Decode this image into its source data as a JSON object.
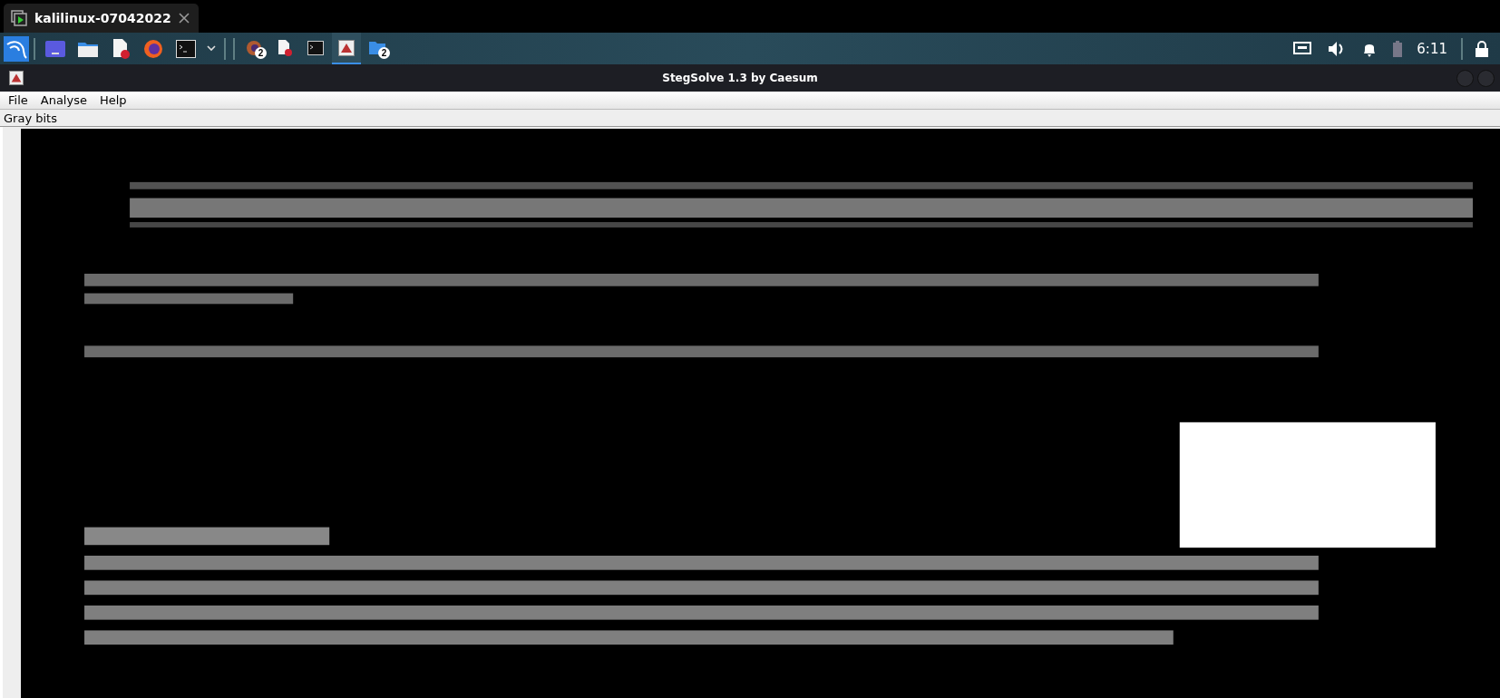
{
  "vm_tab": {
    "title": "kalilinux-07042022"
  },
  "taskbar": {
    "launchers": [
      {
        "kind": "kali"
      },
      {
        "kind": "desktop"
      },
      {
        "kind": "folder"
      },
      {
        "kind": "editor"
      },
      {
        "kind": "firefox"
      },
      {
        "kind": "terminal"
      },
      {
        "kind": "caret"
      }
    ],
    "tasks": [
      {
        "kind": "firefox",
        "badge": "2",
        "selected": false
      },
      {
        "kind": "editor",
        "selected": false
      },
      {
        "kind": "terminal",
        "selected": false
      },
      {
        "kind": "java",
        "selected": true
      },
      {
        "kind": "folder",
        "badge": "2",
        "selected": false
      }
    ],
    "tray": [
      {
        "kind": "network"
      },
      {
        "kind": "volume"
      },
      {
        "kind": "bell"
      },
      {
        "kind": "battery"
      }
    ],
    "clock": "6:11"
  },
  "window": {
    "title": "StegSolve 1.3 by Caesum",
    "menu": [
      "File",
      "Analyse",
      "Help"
    ],
    "view_label": "Gray bits",
    "image": {
      "kind": "picture"
    }
  }
}
